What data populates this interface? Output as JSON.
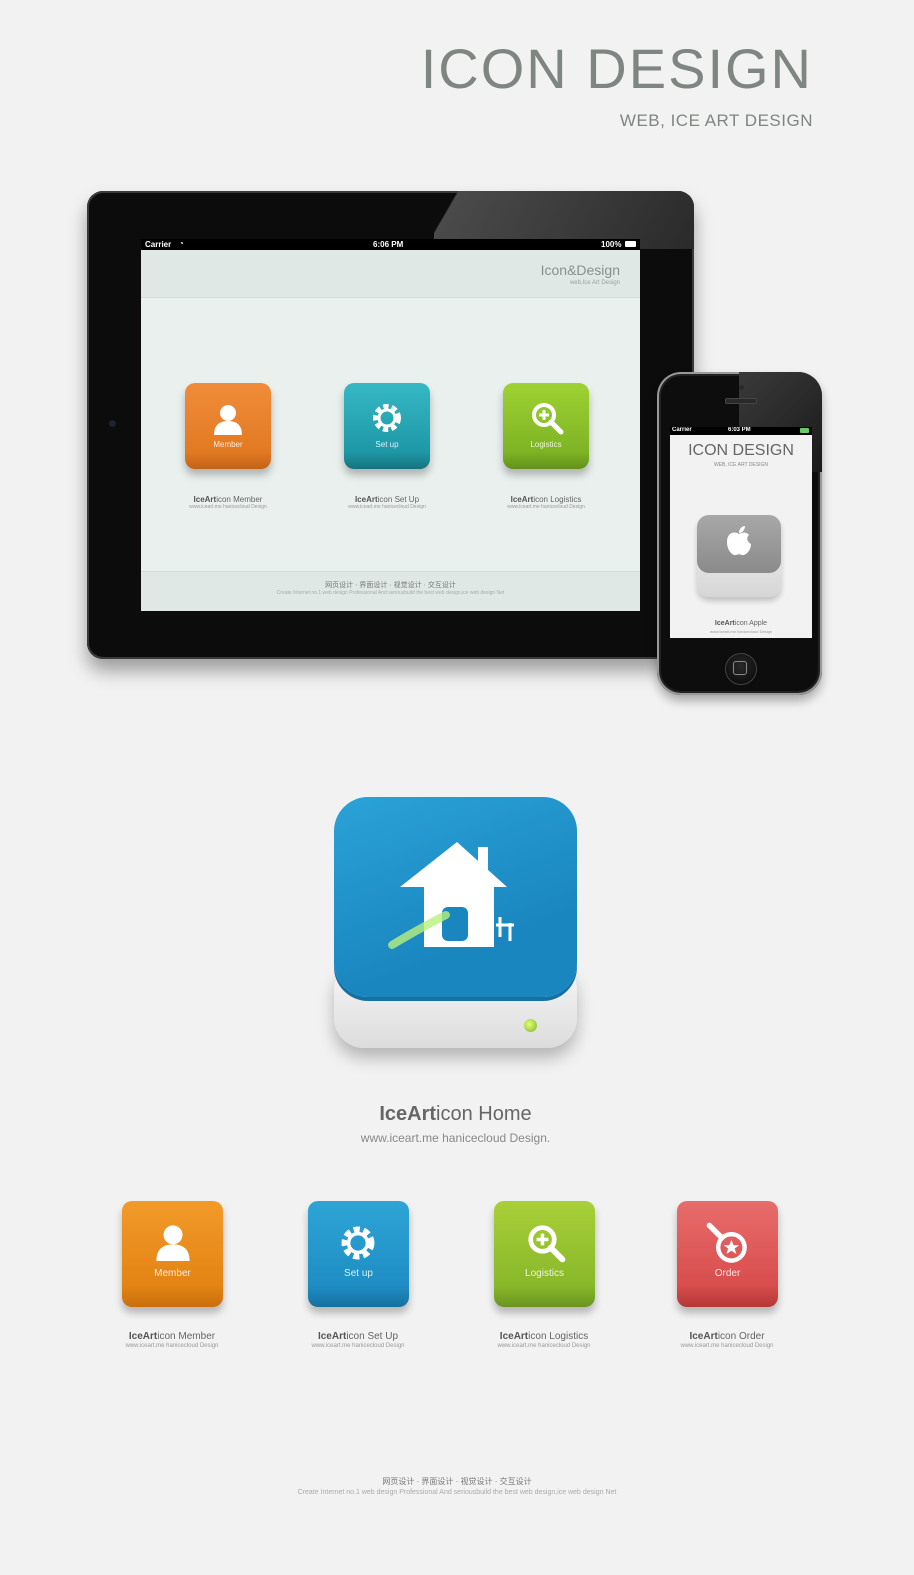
{
  "header": {
    "title": "ICON DESIGN",
    "subtitle": "WEB, ICE ART DESIGN"
  },
  "ipad": {
    "status": {
      "carrier": "Carrier",
      "time": "6:06 PM",
      "battery": "100%"
    },
    "app_title": "Icon&Design",
    "app_subtitle": "web,Ice Art Design",
    "icons": [
      {
        "label": "Member",
        "caption_brand": "IceArt",
        "caption_word": "icon",
        "caption_name": "Member",
        "url": "www.iceart.me hanicecloud Design"
      },
      {
        "label": "Set up",
        "caption_brand": "IceArt",
        "caption_word": "icon",
        "caption_name": "Set Up",
        "url": "www.iceart.me hanicecloud Design"
      },
      {
        "label": "Logistics",
        "caption_brand": "IceArt",
        "caption_word": "icon",
        "caption_name": "Logistics",
        "url": "www.iceart.me hanicecloud Design"
      }
    ],
    "footer_links": "网页设计 · 界面设计 · 视觉设计 · 交互设计",
    "footer_text": "Create Internet no.1 web design Professional And seriousbuild the best web design,ice web design Net"
  },
  "iphone": {
    "status": {
      "carrier": "Carrier",
      "time": "6:03 PM"
    },
    "title": "ICON DESIGN",
    "subtitle": "WEB, ICE ART DESIGN",
    "caption_brand": "IceArt",
    "caption_word": "icon",
    "caption_name": "Apple",
    "url": "www.iceart.me hanicecloud Design"
  },
  "hero": {
    "brand": "IceArt",
    "word": "icon",
    "name": "Home",
    "url": "www.iceart.me hanicecloud Design."
  },
  "row_icons": [
    {
      "label": "Member",
      "brand": "IceArt",
      "word": "icon",
      "name": "Member",
      "url": "www.iceart.me hanicecloud Design"
    },
    {
      "label": "Set up",
      "brand": "IceArt",
      "word": "icon",
      "name": "Set Up",
      "url": "www.iceart.me hanicecloud Design"
    },
    {
      "label": "Logistics",
      "brand": "IceArt",
      "word": "icon",
      "name": "Logistics",
      "url": "www.iceart.me hanicecloud Design"
    },
    {
      "label": "Order",
      "brand": "IceArt",
      "word": "icon",
      "name": "Order",
      "url": "www.iceart.me hanicecloud Design"
    }
  ],
  "footer": {
    "links": "网页设计 · 界面设计 · 视觉设计 · 交互设计",
    "text": "Create Internet no.1 web design Professional And seriousbuild the best web design,ice web design Net"
  },
  "icons_semantic": [
    "user-icon",
    "gear-icon",
    "magnifier-plus-icon",
    "magnifier-star-icon",
    "apple-icon",
    "house-icon",
    "wifi-icon",
    "battery-icon"
  ],
  "colors": {
    "background": "#f2f2f2",
    "title": "#7f8580",
    "orange": "#e38414",
    "blue": "#1e8ec4",
    "green": "#88b82a",
    "red": "#d94d4d"
  }
}
